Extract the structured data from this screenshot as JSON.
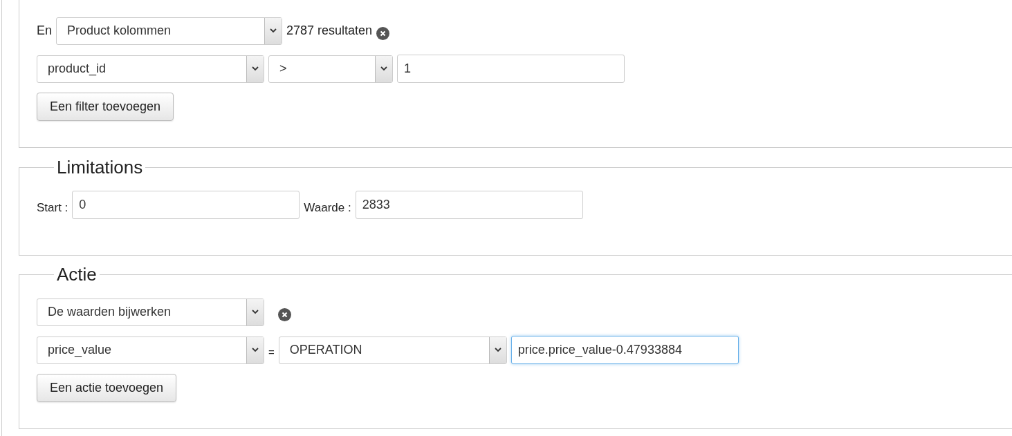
{
  "filter": {
    "conjunction": "En",
    "group_select": "Product kolommen",
    "result_count": "2787 resultaten",
    "conditions": [
      {
        "column": "product_id",
        "operator": ">",
        "value": "1",
        "focused": false
      }
    ],
    "add_button": "Een filter toevoegen"
  },
  "limitations": {
    "legend": "Limitations",
    "fields": [
      {
        "label": "Start :",
        "value": "0"
      },
      {
        "label": "Waarde :",
        "value": "2833"
      }
    ]
  },
  "action": {
    "legend": "Actie",
    "type_select": "De waarden bijwerken",
    "assignments": [
      {
        "column": "price_value",
        "equals": "=",
        "mode": "OPERATION",
        "value": "price.price_value-0.47933884",
        "focused": true
      }
    ],
    "add_button": "Een actie toevoegen"
  }
}
